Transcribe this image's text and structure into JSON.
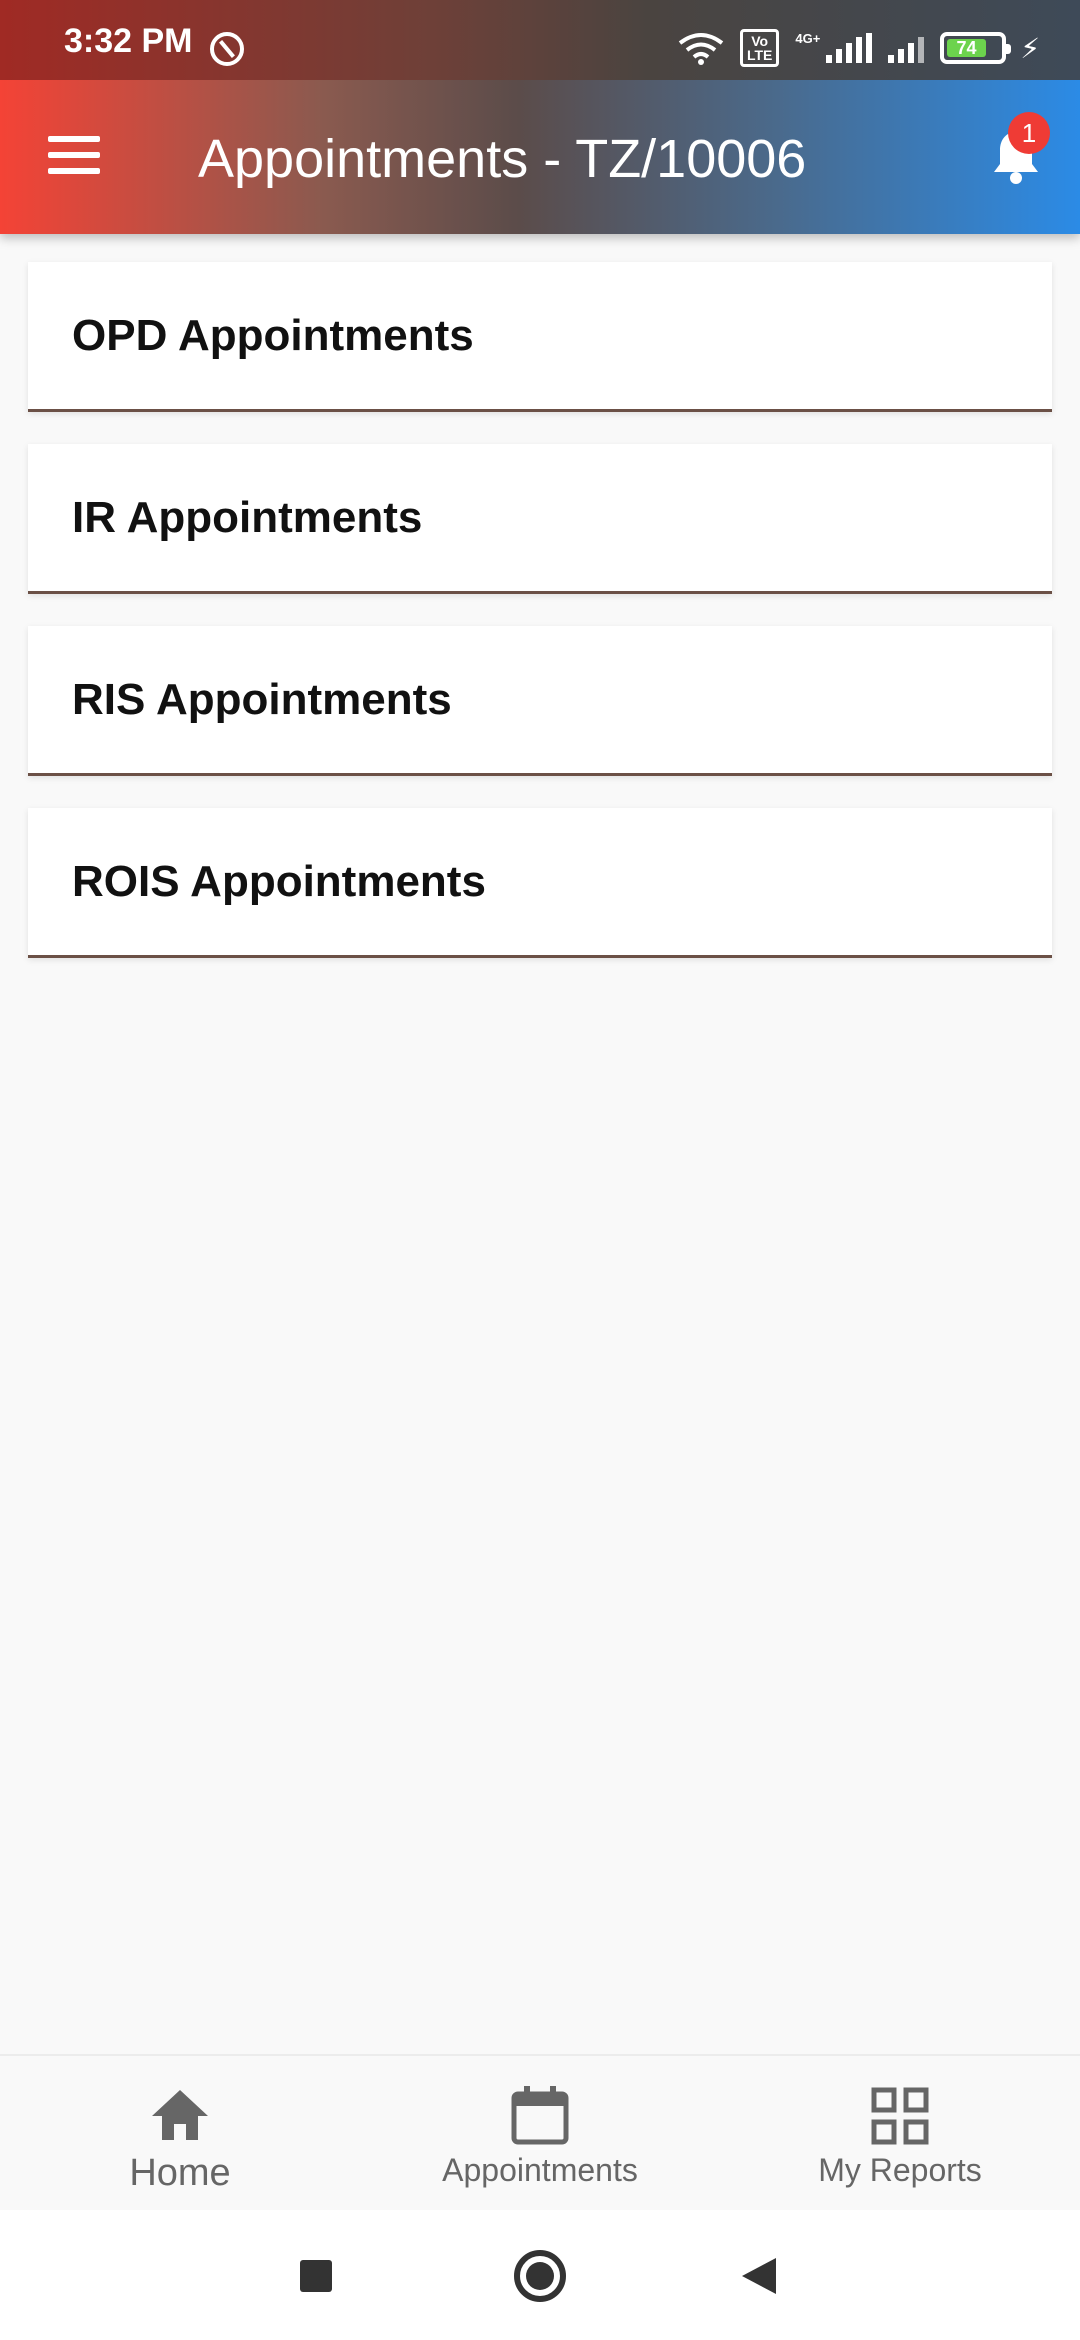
{
  "status_bar": {
    "time": "3:32 PM",
    "network_label": "4G+",
    "volte_top": "Vo",
    "volte_bottom": "LTE",
    "battery_percent": "74"
  },
  "app_bar": {
    "title": "Appointments - TZ/10006",
    "notification_count": "1"
  },
  "appointments": [
    {
      "label": "OPD Appointments"
    },
    {
      "label": "IR Appointments"
    },
    {
      "label": "RIS Appointments"
    },
    {
      "label": "ROIS Appointments"
    }
  ],
  "bottom_nav": {
    "home": "Home",
    "appointments": "Appointments",
    "reports": "My Reports"
  }
}
